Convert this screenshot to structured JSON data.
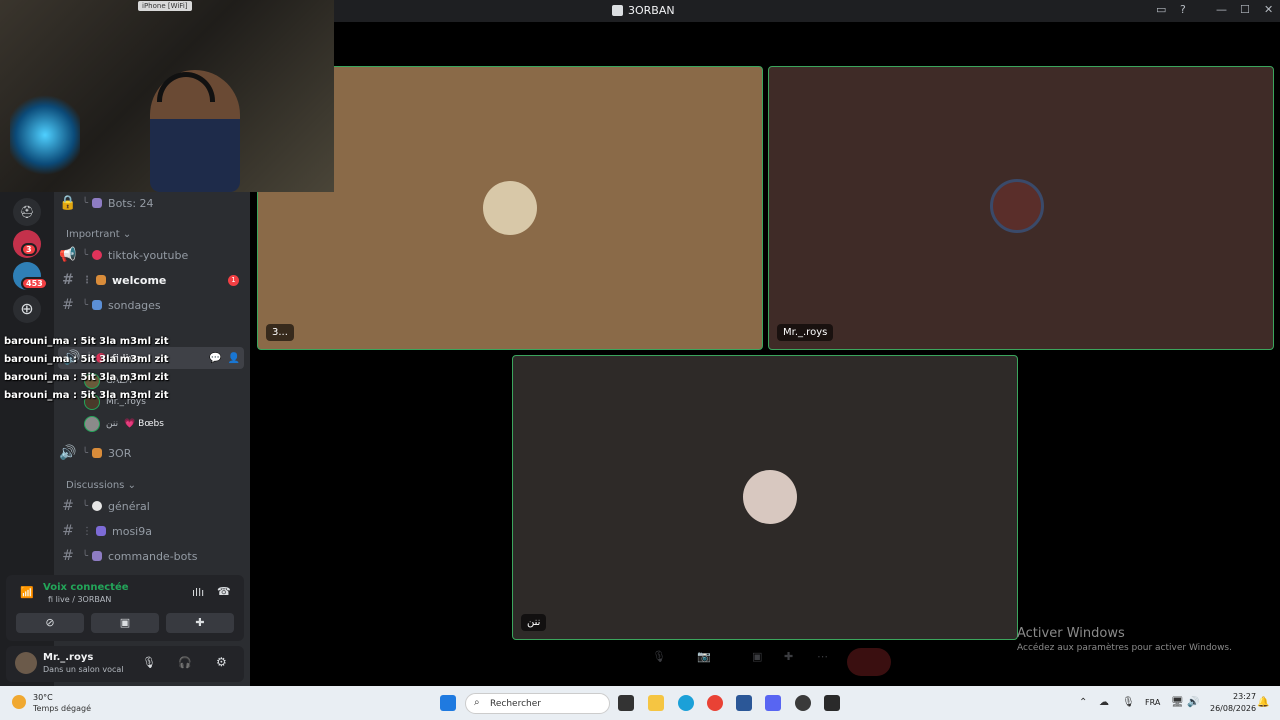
{
  "window": {
    "title": "3ORBAN"
  },
  "webcam": {
    "label": "iPhone [WiFi]"
  },
  "rail": {
    "badges": [
      "3",
      "453"
    ]
  },
  "sidebar": {
    "bots_channel": "Bots: 24",
    "category_important": "Importrant",
    "channels_important": [
      {
        "name": "tiktok-youtube",
        "type": "announcement"
      },
      {
        "name": "welcome",
        "type": "text",
        "unread": "1"
      },
      {
        "name": "sondages",
        "type": "text"
      }
    ],
    "voice_channel": {
      "name": "fi live"
    },
    "voice_users": [
      {
        "name": "GAZA"
      },
      {
        "name": "Mr._.roys"
      },
      {
        "name": "ننن",
        "tag": "💗 Bœbs"
      }
    ],
    "voice_channel2": {
      "name": "3OR"
    },
    "category_discussions": "Discussions",
    "channels_discussions": [
      {
        "name": "général"
      },
      {
        "name": "mosi9a"
      },
      {
        "name": "commande-bots"
      }
    ]
  },
  "voice_panel": {
    "status": "Voix connectée",
    "channel": "fi live / 3ORBAN"
  },
  "user_panel": {
    "name": "Mr._.roys",
    "status": "Dans un salon vocal"
  },
  "chat_overlay": [
    "barouni_ma : 5it 3la m3ml zit",
    "barouni_ma : 5it 3la m3ml zit",
    "barouni_ma : 5it 3la m3ml zit",
    "barouni_ma : 5it 3la m3ml zit"
  ],
  "tiles": [
    {
      "name": "3...",
      "color": "#8a6a48"
    },
    {
      "name": "Mr._.roys",
      "color": "#3f2b27"
    },
    {
      "name": "ننن",
      "color": "#2e2a28"
    }
  ],
  "watermark": {
    "title": "Activer Windows",
    "subtitle": "Accédez aux paramètres pour activer Windows."
  },
  "taskbar": {
    "weather_temp": "30°C",
    "weather_desc": "Temps dégagé",
    "search_placeholder": "Rechercher",
    "language": "FRA",
    "time": "23:27",
    "date": "26/08/2026"
  }
}
